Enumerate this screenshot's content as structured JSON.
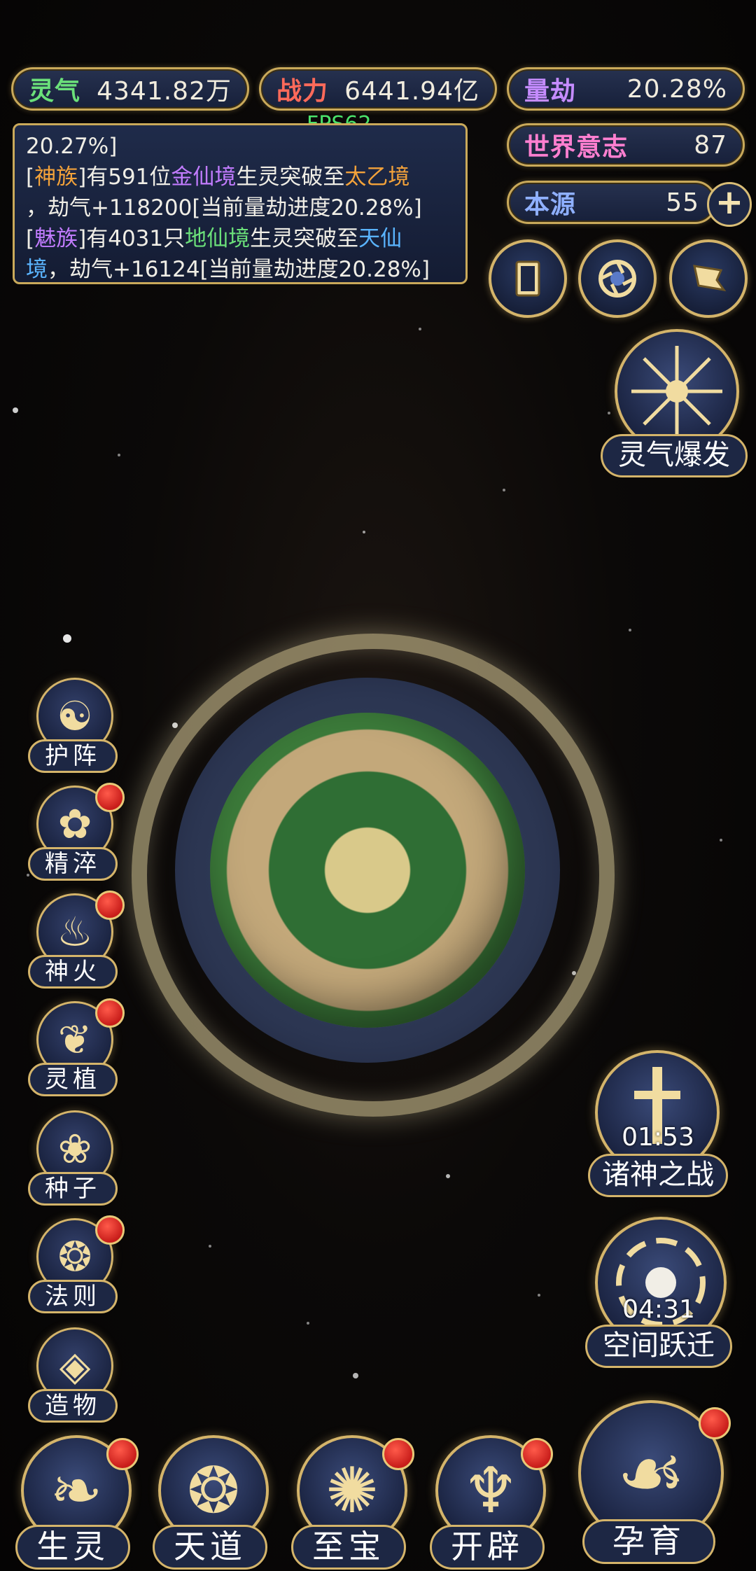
{
  "resources": {
    "lingqi_label": "灵气",
    "lingqi_value": "4341.82万",
    "zhanli_label": "战力",
    "zhanli_value": "6441.94亿",
    "liangjie_label": "量劫",
    "liangjie_value": "20.28%",
    "shijie_label": "世界意志",
    "shijie_value": "87",
    "benyuan_label": "本源",
    "benyuan_value": "55",
    "plus_label": "+"
  },
  "fps": "FPS62",
  "log": {
    "line0": "20.27%]",
    "entry1": {
      "open": "[",
      "race": "神族",
      "close": "]",
      "text1": "有591位",
      "realm1": "金仙境",
      "text2": "生灵突破至",
      "realm2": "太乙境",
      "text3": "，劫气+118200[当前量劫进度20.28%]"
    },
    "entry2": {
      "open": "[",
      "race": "魅族",
      "close": "]",
      "text1": "有4031只",
      "realm1": "地仙境",
      "text2": "生灵突破至",
      "realm2a": "天仙",
      "realm2b": "境",
      "text3": "，劫气+16124[当前量劫进度20.28%]"
    }
  },
  "side_menu": [
    {
      "label": "护阵",
      "badge": false
    },
    {
      "label": "精淬",
      "badge": true
    },
    {
      "label": "神火",
      "badge": true
    },
    {
      "label": "灵植",
      "badge": true
    },
    {
      "label": "种子",
      "badge": false
    },
    {
      "label": "法则",
      "badge": true
    },
    {
      "label": "造物",
      "badge": false
    }
  ],
  "right_buttons": {
    "burst_label": "灵气爆发",
    "battle_label": "诸神之战",
    "battle_timer": "01:53",
    "leap_label": "空间跃迁",
    "leap_timer": "04:31"
  },
  "bottom_nav": [
    {
      "label": "生灵",
      "badge": true
    },
    {
      "label": "天道",
      "badge": false
    },
    {
      "label": "至宝",
      "badge": true
    },
    {
      "label": "开辟",
      "badge": true
    },
    {
      "label": "孕育",
      "badge": true
    }
  ],
  "colors": {
    "gold_border": "#c9a95a",
    "panel_navy": "#1d2744",
    "badge_red": "#d8231f",
    "planet_green": "#3c7b3a"
  }
}
